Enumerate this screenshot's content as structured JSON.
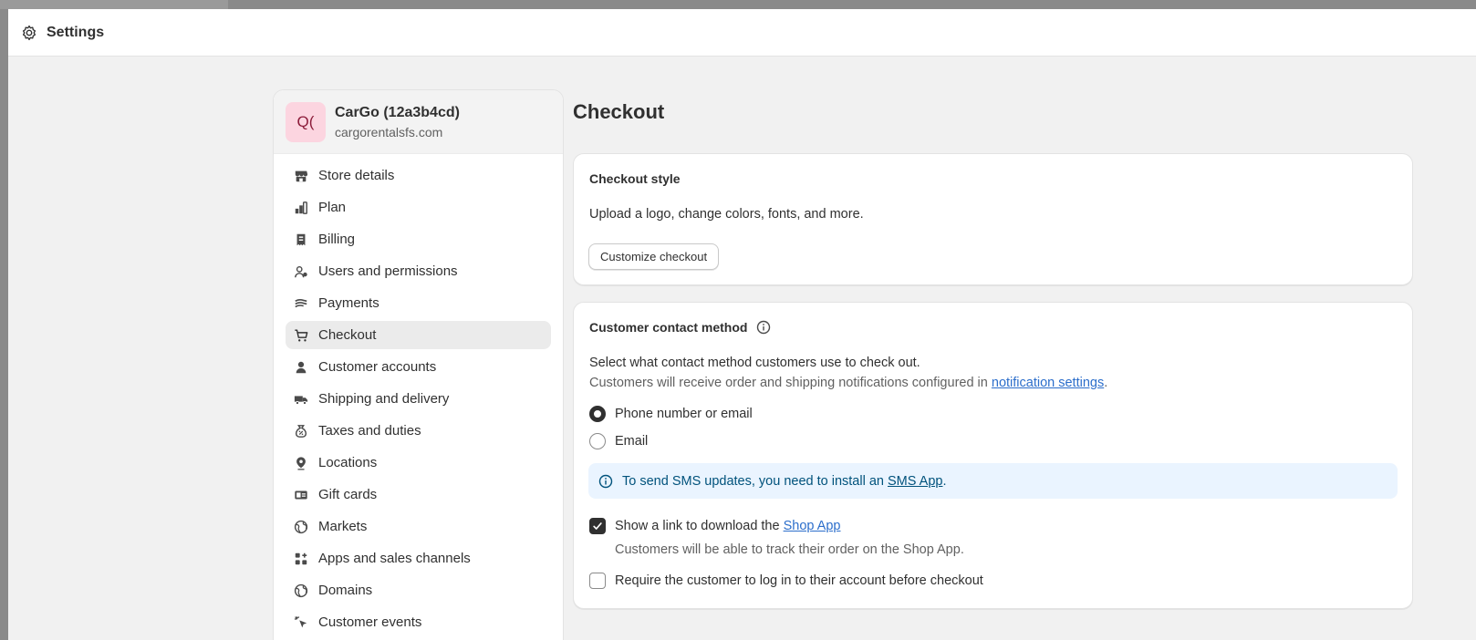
{
  "header": {
    "title": "Settings",
    "icon": "gear-icon"
  },
  "store": {
    "initials": "Q(",
    "name": "CarGo (12a3b4cd)",
    "domain": "cargorentalsfs.com",
    "avatar_color": "#fcd5e0"
  },
  "sidebar": {
    "items": [
      {
        "label": "Store details",
        "icon": "store-icon",
        "active": false
      },
      {
        "label": "Plan",
        "icon": "plan-icon",
        "active": false
      },
      {
        "label": "Billing",
        "icon": "receipt-icon",
        "active": false
      },
      {
        "label": "Users and permissions",
        "icon": "users-icon",
        "active": false
      },
      {
        "label": "Payments",
        "icon": "payments-icon",
        "active": false
      },
      {
        "label": "Checkout",
        "icon": "cart-icon",
        "active": true
      },
      {
        "label": "Customer accounts",
        "icon": "person-icon",
        "active": false
      },
      {
        "label": "Shipping and delivery",
        "icon": "truck-icon",
        "active": false
      },
      {
        "label": "Taxes and duties",
        "icon": "tax-icon",
        "active": false
      },
      {
        "label": "Locations",
        "icon": "location-icon",
        "active": false
      },
      {
        "label": "Gift cards",
        "icon": "gift-card-icon",
        "active": false
      },
      {
        "label": "Markets",
        "icon": "globe-icon",
        "active": false
      },
      {
        "label": "Apps and sales channels",
        "icon": "apps-icon",
        "active": false
      },
      {
        "label": "Domains",
        "icon": "globe-icon",
        "active": false
      },
      {
        "label": "Customer events",
        "icon": "cursor-icon",
        "active": false
      }
    ]
  },
  "main": {
    "title": "Checkout",
    "checkout_style": {
      "title": "Checkout style",
      "description": "Upload a logo, change colors, fonts, and more.",
      "button": "Customize checkout"
    },
    "contact_method": {
      "title": "Customer contact method",
      "prompt": "Select what contact method customers use to check out.",
      "note_prefix": "Customers will receive order and shipping notifications configured in ",
      "note_link": "notification settings",
      "note_suffix": ".",
      "options": [
        {
          "label": "Phone number or email",
          "selected": true
        },
        {
          "label": "Email",
          "selected": false
        }
      ],
      "banner": {
        "prefix": "To send SMS updates, you need to install an ",
        "link": "SMS App",
        "suffix": "."
      },
      "shop_app": {
        "prefix": "Show a link to download the ",
        "link": "Shop App",
        "checked": true,
        "help": "Customers will be able to track their order on the Shop App."
      },
      "require_login": {
        "label": "Require the customer to log in to their account before checkout",
        "checked": false
      }
    }
  },
  "colors": {
    "link": "#2c6ecb",
    "banner_bg": "#eaf4ff",
    "active_nav": "#ebebeb"
  }
}
